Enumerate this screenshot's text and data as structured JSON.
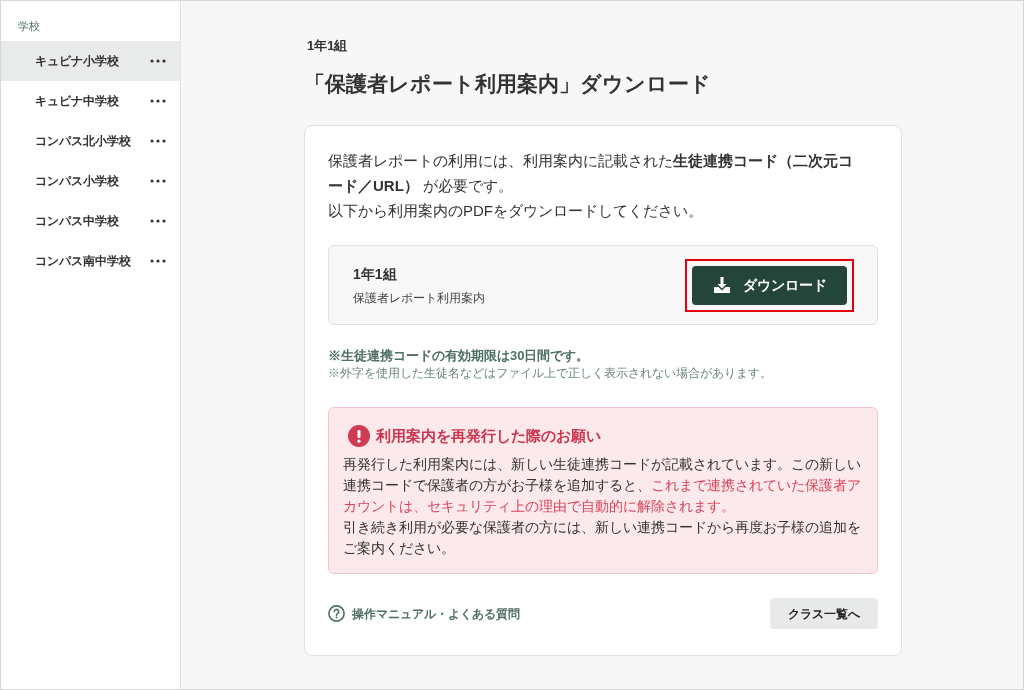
{
  "sidebar": {
    "heading": "学校",
    "items": [
      {
        "label": "キュビナ小学校",
        "selected": true
      },
      {
        "label": "キュビナ中学校",
        "selected": false
      },
      {
        "label": "コンパス北小学校",
        "selected": false
      },
      {
        "label": "コンパス小学校",
        "selected": false
      },
      {
        "label": "コンパス中学校",
        "selected": false
      },
      {
        "label": "コンパス南中学校",
        "selected": false
      }
    ]
  },
  "page": {
    "class_label": "1年1組",
    "title": "「保護者レポート利用案内」ダウンロード"
  },
  "intro": [
    "保護者レポートの利用には、利用案内に記載された**生徒連携コード（二次元コード／URL）** が必要です。",
    "以下から利用案内のPDFをダウンロードしてください。"
  ],
  "download_item": {
    "title": "1年1組",
    "subtitle": "保護者レポート利用案内",
    "button": {
      "label": "ダウンロード",
      "highlighted": true
    }
  },
  "notes": [
    {
      "kind": "emphasis",
      "text": "※生徒連携コードの有効期限は30日間です。"
    },
    {
      "kind": "small",
      "text": "※外字を使用した生徒名などはファイル上で正しく表示されない場合があります。"
    }
  ],
  "alert": {
    "title": "利用案内を再発行した際のお願い",
    "paragraphs": [
      [
        {
          "text": "再発行した利用案内には、新しい生徒連携コードが記載されています。この新しい連携コードで保護者の方がお子様を追加すると、",
          "warning": false
        },
        {
          "text": "これまで連携されていた保護者アカウントは、セキュリティ上の理由で自動的に解除されます。",
          "warning": true
        }
      ],
      [
        {
          "text": "引き続き利用が必要な保護者の方には、新しい連携コードから再度お子様の追加をご案内ください。",
          "warning": false
        }
      ]
    ]
  },
  "footer": {
    "help_link": "操作マニュアル・よくある質問",
    "back_button": "クラス一覧へ"
  }
}
